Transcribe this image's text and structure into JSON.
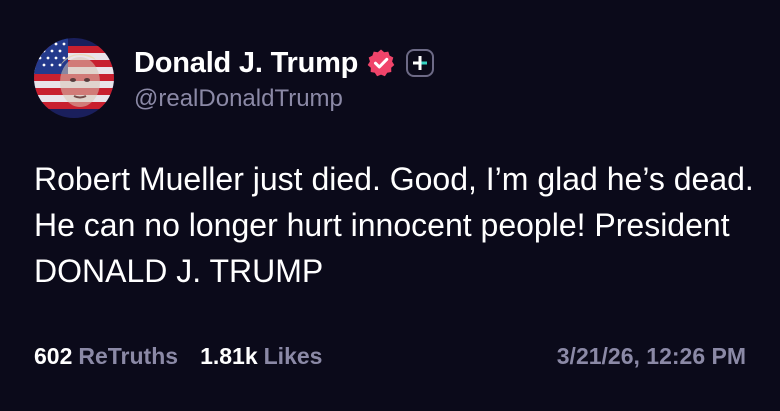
{
  "post": {
    "author": {
      "display_name": "Donald J. Trump",
      "handle": "@realDonaldTrump",
      "verified_icon": "verified-badge-icon",
      "avatar_icon": "profile-avatar"
    },
    "text": "Robert Mueller just died. Good, I’m glad he’s dead. He can no longer hurt innocent people! President DONALD J. TRUMP",
    "stats": {
      "retruths_count": "602",
      "retruths_label": "ReTruths",
      "likes_count": "1.81k",
      "likes_label": "Likes"
    },
    "timestamp": "3/21/26, 12:26 PM"
  },
  "colors": {
    "background": "#0b0a1a",
    "text": "#ffffff",
    "muted": "#8b89a6",
    "verified": "#f0446a"
  }
}
